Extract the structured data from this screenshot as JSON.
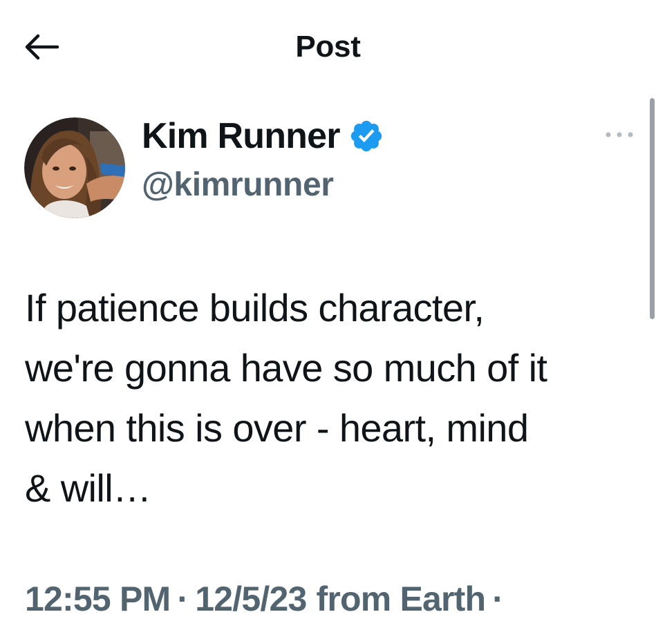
{
  "header": {
    "back_icon": "arrow-left-icon",
    "title": "Post"
  },
  "post": {
    "author": {
      "display_name": "Kim Runner",
      "handle": "@kimrunner",
      "verified": true,
      "verified_icon": "verified-badge-icon",
      "badge_color": "#1d9bf0"
    },
    "more_icon": "more-horizontal-icon",
    "text": "If patience builds character,\nwe're gonna have so much of it\nwhen this is over - heart, mind\n& will…",
    "meta": {
      "time": "12:55 PM",
      "separator": "·",
      "date": "12/5/23",
      "source": "from Earth",
      "trailing_separator": "·"
    }
  },
  "colors": {
    "text_primary": "#0f1419",
    "text_secondary": "#536471",
    "accent": "#1d9bf0"
  }
}
